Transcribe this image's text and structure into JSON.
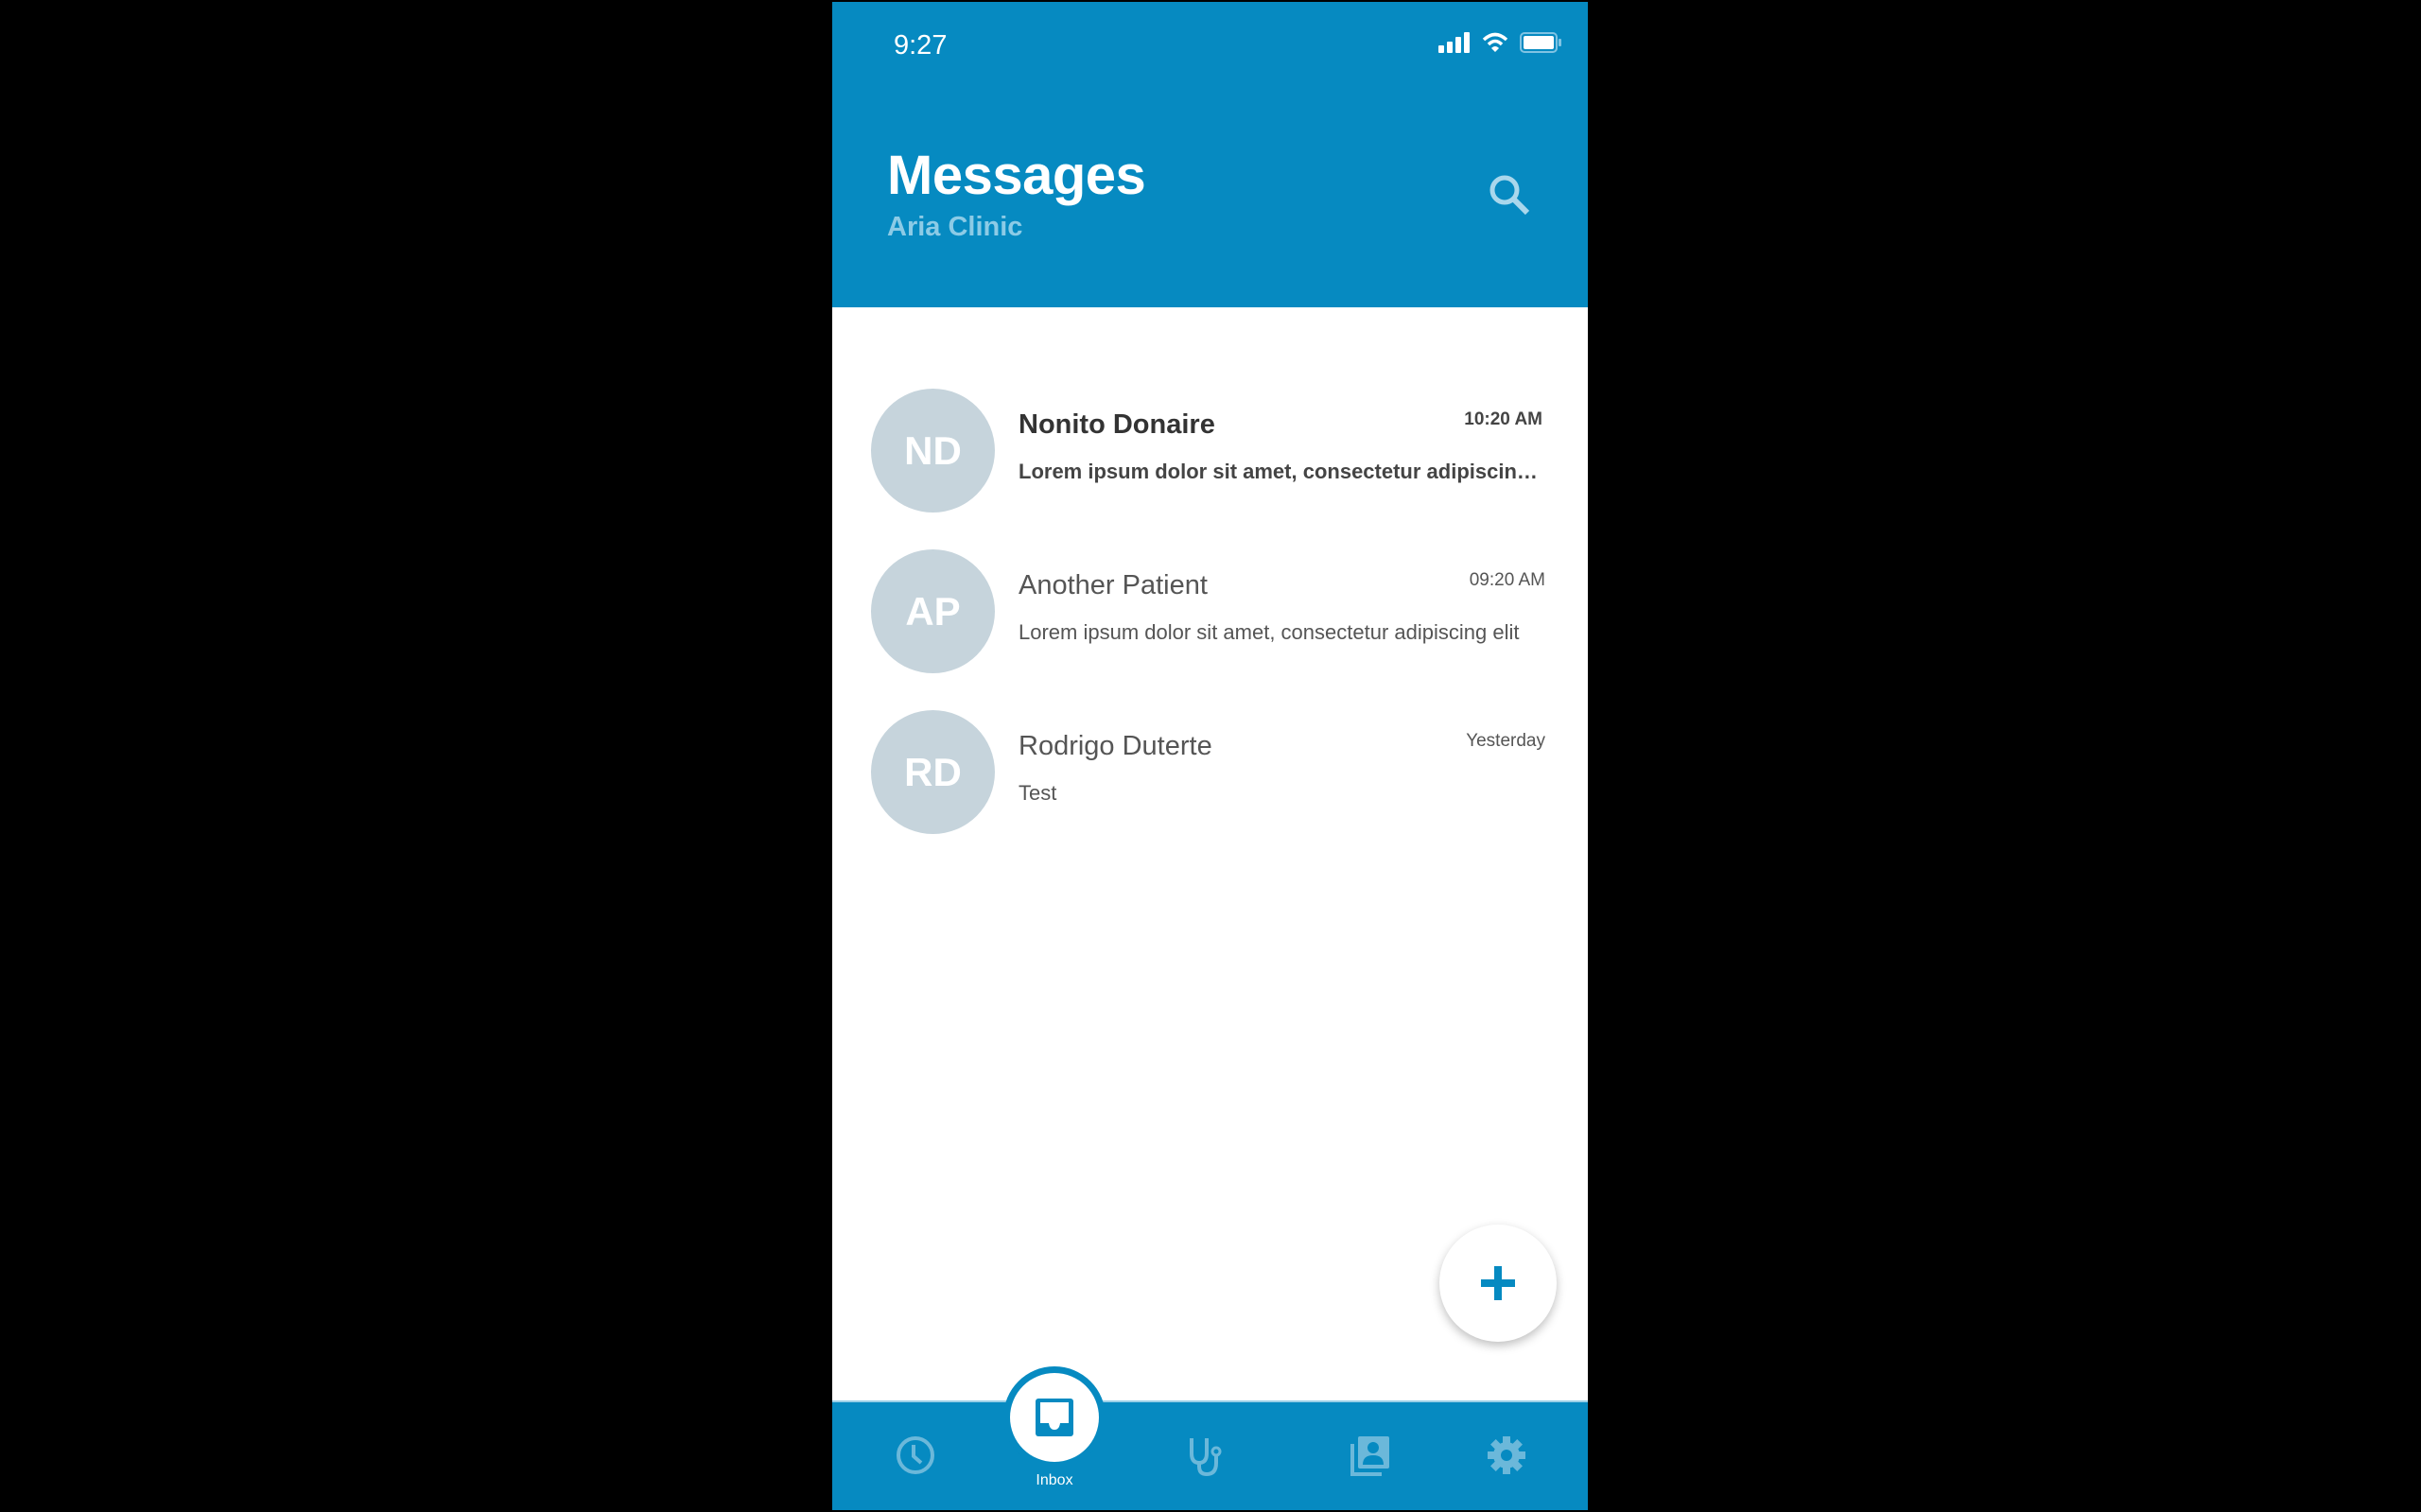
{
  "status_bar": {
    "time": "9:27",
    "icons": [
      "signal-icon",
      "wifi-icon",
      "battery-icon"
    ]
  },
  "header": {
    "title": "Messages",
    "subtitle": "Aria Clinic",
    "search_icon": "search-icon"
  },
  "conversations": [
    {
      "initials": "ND",
      "name": "Nonito Donaire",
      "preview": "Lorem ipsum dolor sit amet, consectetur adipiscing elit",
      "time": "10:20 AM",
      "unread": true
    },
    {
      "initials": "AP",
      "name": "Another Patient",
      "preview": "Lorem ipsum dolor sit amet, consectetur adipiscing elit",
      "time": "09:20 AM",
      "unread": false
    },
    {
      "initials": "RD",
      "name": "Rodrigo Duterte",
      "preview": "Test",
      "time": "Yesterday",
      "unread": false
    }
  ],
  "fab": {
    "icon": "plus-icon"
  },
  "nav": {
    "items": [
      {
        "icon": "clock-icon"
      },
      {
        "icon": "inbox-icon",
        "label": "Inbox",
        "active": true
      },
      {
        "icon": "stethoscope-icon"
      },
      {
        "icon": "contacts-icon"
      },
      {
        "icon": "gear-icon"
      }
    ]
  },
  "colors": {
    "primary": "#068ac1",
    "avatar": "#c6d4dc",
    "inactive_icon": "#6bb8da"
  }
}
